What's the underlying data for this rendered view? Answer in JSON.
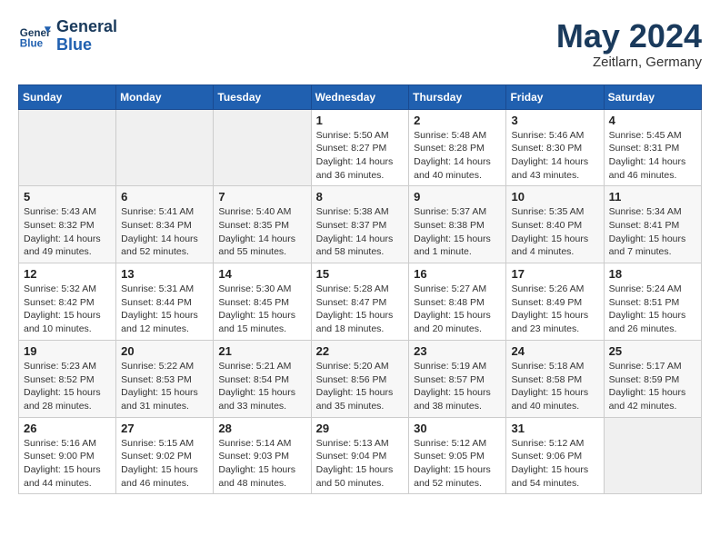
{
  "header": {
    "logo_line1": "General",
    "logo_line2": "Blue",
    "month_year": "May 2024",
    "location": "Zeitlarn, Germany"
  },
  "days_of_week": [
    "Sunday",
    "Monday",
    "Tuesday",
    "Wednesday",
    "Thursday",
    "Friday",
    "Saturday"
  ],
  "weeks": [
    [
      {
        "day": "",
        "text": ""
      },
      {
        "day": "",
        "text": ""
      },
      {
        "day": "",
        "text": ""
      },
      {
        "day": "1",
        "text": "Sunrise: 5:50 AM\nSunset: 8:27 PM\nDaylight: 14 hours\nand 36 minutes."
      },
      {
        "day": "2",
        "text": "Sunrise: 5:48 AM\nSunset: 8:28 PM\nDaylight: 14 hours\nand 40 minutes."
      },
      {
        "day": "3",
        "text": "Sunrise: 5:46 AM\nSunset: 8:30 PM\nDaylight: 14 hours\nand 43 minutes."
      },
      {
        "day": "4",
        "text": "Sunrise: 5:45 AM\nSunset: 8:31 PM\nDaylight: 14 hours\nand 46 minutes."
      }
    ],
    [
      {
        "day": "5",
        "text": "Sunrise: 5:43 AM\nSunset: 8:32 PM\nDaylight: 14 hours\nand 49 minutes."
      },
      {
        "day": "6",
        "text": "Sunrise: 5:41 AM\nSunset: 8:34 PM\nDaylight: 14 hours\nand 52 minutes."
      },
      {
        "day": "7",
        "text": "Sunrise: 5:40 AM\nSunset: 8:35 PM\nDaylight: 14 hours\nand 55 minutes."
      },
      {
        "day": "8",
        "text": "Sunrise: 5:38 AM\nSunset: 8:37 PM\nDaylight: 14 hours\nand 58 minutes."
      },
      {
        "day": "9",
        "text": "Sunrise: 5:37 AM\nSunset: 8:38 PM\nDaylight: 15 hours\nand 1 minute."
      },
      {
        "day": "10",
        "text": "Sunrise: 5:35 AM\nSunset: 8:40 PM\nDaylight: 15 hours\nand 4 minutes."
      },
      {
        "day": "11",
        "text": "Sunrise: 5:34 AM\nSunset: 8:41 PM\nDaylight: 15 hours\nand 7 minutes."
      }
    ],
    [
      {
        "day": "12",
        "text": "Sunrise: 5:32 AM\nSunset: 8:42 PM\nDaylight: 15 hours\nand 10 minutes."
      },
      {
        "day": "13",
        "text": "Sunrise: 5:31 AM\nSunset: 8:44 PM\nDaylight: 15 hours\nand 12 minutes."
      },
      {
        "day": "14",
        "text": "Sunrise: 5:30 AM\nSunset: 8:45 PM\nDaylight: 15 hours\nand 15 minutes."
      },
      {
        "day": "15",
        "text": "Sunrise: 5:28 AM\nSunset: 8:47 PM\nDaylight: 15 hours\nand 18 minutes."
      },
      {
        "day": "16",
        "text": "Sunrise: 5:27 AM\nSunset: 8:48 PM\nDaylight: 15 hours\nand 20 minutes."
      },
      {
        "day": "17",
        "text": "Sunrise: 5:26 AM\nSunset: 8:49 PM\nDaylight: 15 hours\nand 23 minutes."
      },
      {
        "day": "18",
        "text": "Sunrise: 5:24 AM\nSunset: 8:51 PM\nDaylight: 15 hours\nand 26 minutes."
      }
    ],
    [
      {
        "day": "19",
        "text": "Sunrise: 5:23 AM\nSunset: 8:52 PM\nDaylight: 15 hours\nand 28 minutes."
      },
      {
        "day": "20",
        "text": "Sunrise: 5:22 AM\nSunset: 8:53 PM\nDaylight: 15 hours\nand 31 minutes."
      },
      {
        "day": "21",
        "text": "Sunrise: 5:21 AM\nSunset: 8:54 PM\nDaylight: 15 hours\nand 33 minutes."
      },
      {
        "day": "22",
        "text": "Sunrise: 5:20 AM\nSunset: 8:56 PM\nDaylight: 15 hours\nand 35 minutes."
      },
      {
        "day": "23",
        "text": "Sunrise: 5:19 AM\nSunset: 8:57 PM\nDaylight: 15 hours\nand 38 minutes."
      },
      {
        "day": "24",
        "text": "Sunrise: 5:18 AM\nSunset: 8:58 PM\nDaylight: 15 hours\nand 40 minutes."
      },
      {
        "day": "25",
        "text": "Sunrise: 5:17 AM\nSunset: 8:59 PM\nDaylight: 15 hours\nand 42 minutes."
      }
    ],
    [
      {
        "day": "26",
        "text": "Sunrise: 5:16 AM\nSunset: 9:00 PM\nDaylight: 15 hours\nand 44 minutes."
      },
      {
        "day": "27",
        "text": "Sunrise: 5:15 AM\nSunset: 9:02 PM\nDaylight: 15 hours\nand 46 minutes."
      },
      {
        "day": "28",
        "text": "Sunrise: 5:14 AM\nSunset: 9:03 PM\nDaylight: 15 hours\nand 48 minutes."
      },
      {
        "day": "29",
        "text": "Sunrise: 5:13 AM\nSunset: 9:04 PM\nDaylight: 15 hours\nand 50 minutes."
      },
      {
        "day": "30",
        "text": "Sunrise: 5:12 AM\nSunset: 9:05 PM\nDaylight: 15 hours\nand 52 minutes."
      },
      {
        "day": "31",
        "text": "Sunrise: 5:12 AM\nSunset: 9:06 PM\nDaylight: 15 hours\nand 54 minutes."
      },
      {
        "day": "",
        "text": ""
      }
    ]
  ]
}
